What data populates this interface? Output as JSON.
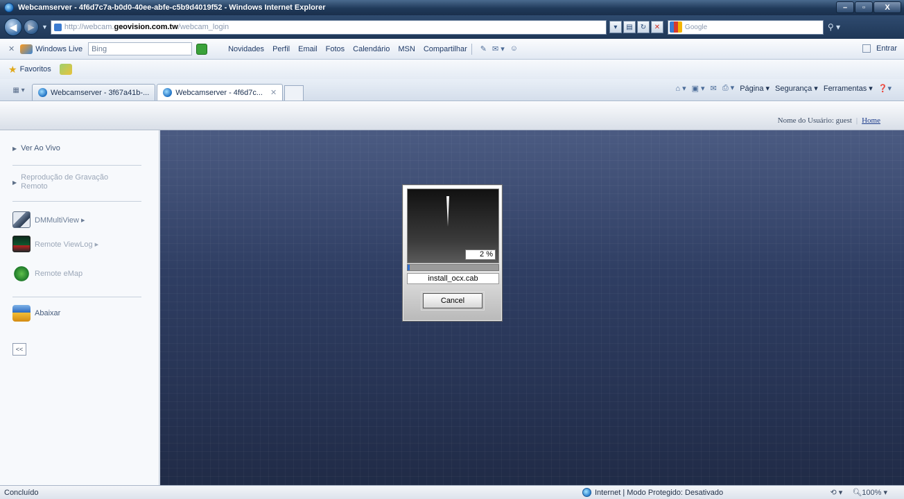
{
  "window": {
    "title": "Webcamserver - 4f6d7c7a-b0d0-40ee-abfe-c5b9d4019f52 - Windows Internet Explorer",
    "controls": {
      "minimize": "–",
      "maximize": "▫",
      "close": "X"
    }
  },
  "addressbar": {
    "url_prefix": "http://webcam.",
    "url_host": "geovision.com.tw",
    "url_suffix": "/webcam_login",
    "search_placeholder": "Google"
  },
  "livebar": {
    "brand": "Windows Live",
    "search_value": "Bing",
    "links": [
      "Novidades",
      "Perfil",
      "Email",
      "Fotos",
      "Calendário",
      "MSN",
      "Compartilhar"
    ],
    "signin": "Entrar"
  },
  "favorites": {
    "label": "Favoritos"
  },
  "tabs": [
    {
      "label": "Webcamserver - 3f67a41b-...",
      "active": false
    },
    {
      "label": "Webcamserver - 4f6d7c...",
      "active": true
    }
  ],
  "commandbar": {
    "page": "Página ▾",
    "security": "Segurança ▾",
    "tools": "Ferramentas ▾"
  },
  "header": {
    "user_label": "Nome do Usuário: guest",
    "separator": "|",
    "home_link": "Home"
  },
  "sidebar": {
    "live_view": "Ver Ao Vivo",
    "remote_playback": "Reprodução de Gravação Remoto",
    "multiview": "DMMultiView ▸",
    "viewlog": "Remote ViewLog ▸",
    "emap": "Remote eMap",
    "download": "Abaixar",
    "collapse": "<<"
  },
  "dialog": {
    "percent_label": "2 %",
    "progress": 0.02,
    "filename": "install_ocx.cab",
    "cancel_label": "Cancel"
  },
  "statusbar": {
    "left": "Concluído",
    "zone": "Internet | Modo Protegido: Desativado",
    "zoom": "100%"
  }
}
